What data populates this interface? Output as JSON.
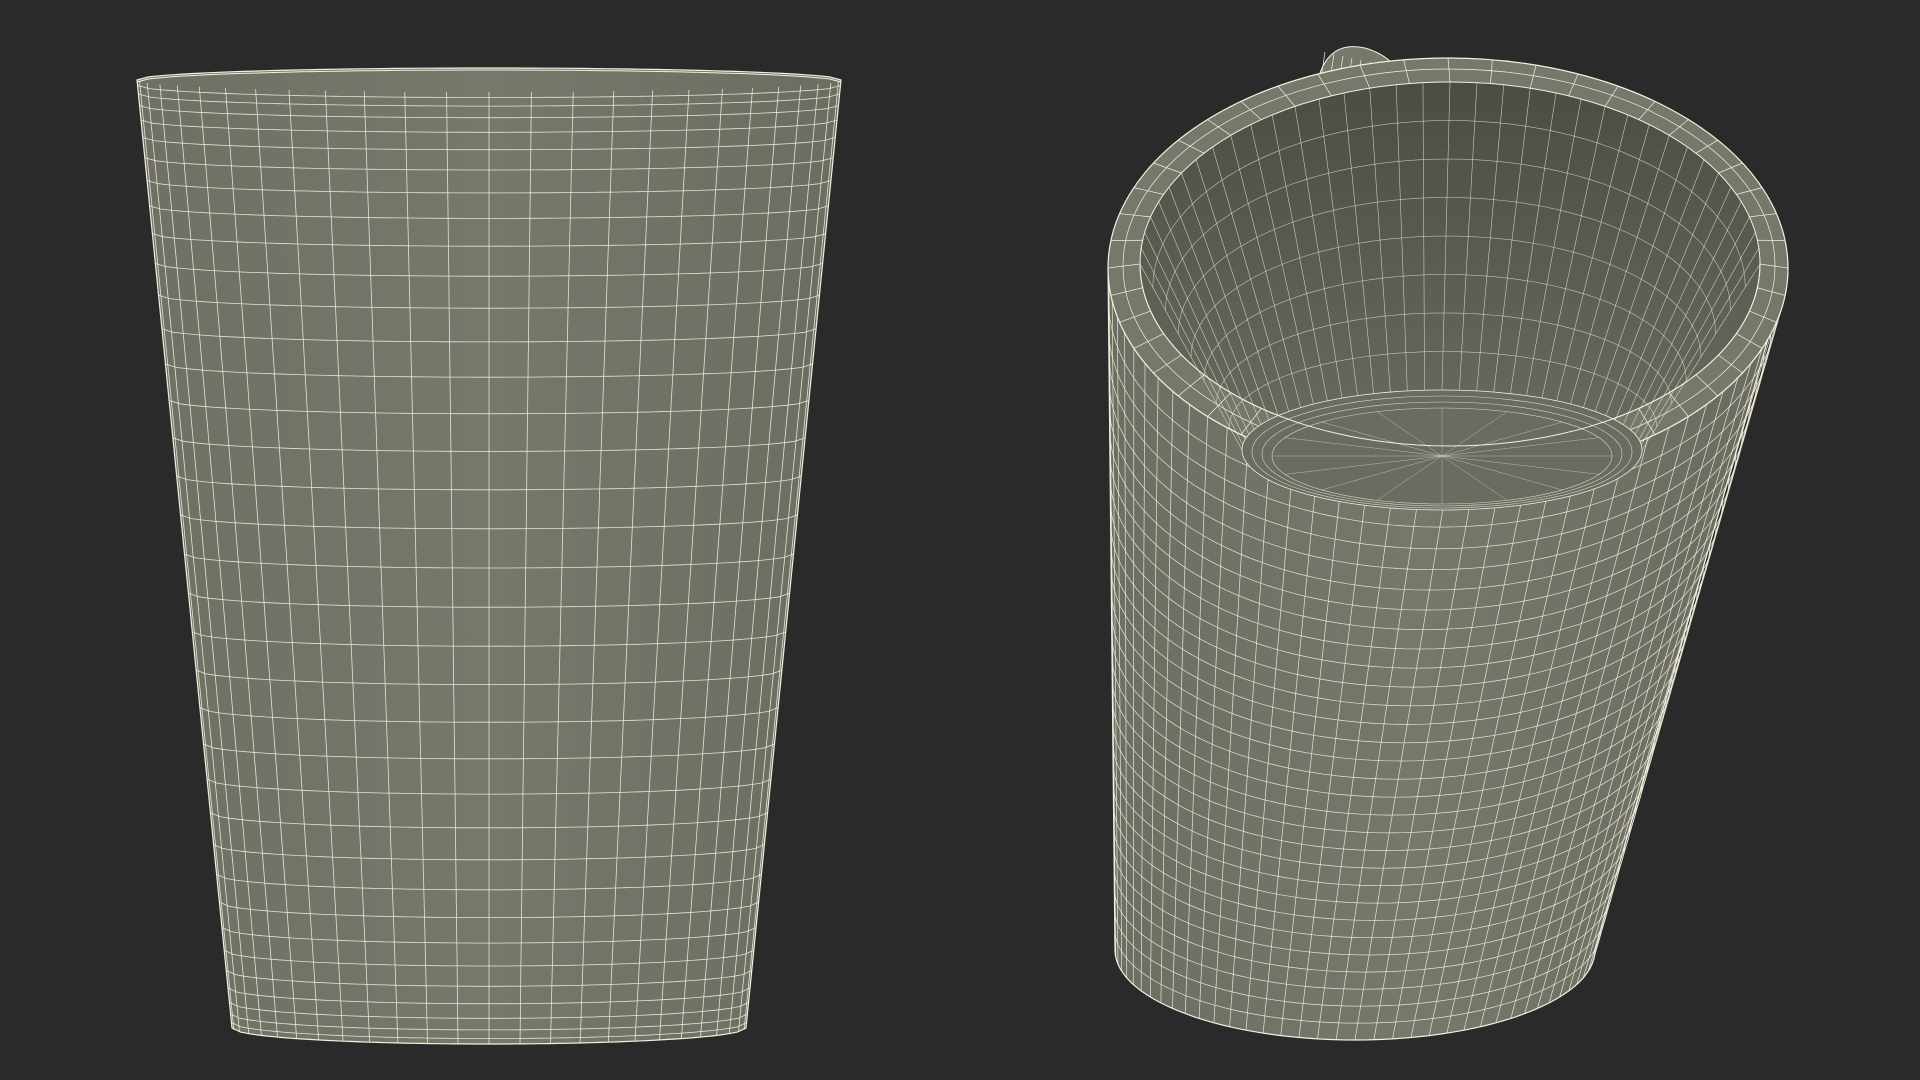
{
  "scene": {
    "background_color": "#2a2a2a",
    "mesh_fill_color": "#77786c",
    "mesh_shadow_color": "#4e4f46",
    "interior_color": "#5b5c52",
    "wire_color": "#f3f0dc"
  },
  "views": [
    {
      "name": "front-orthographic-view",
      "subject": "mug-body-wireframe"
    },
    {
      "name": "perspective-top-view",
      "subject": "mug-with-handle-wireframe"
    }
  ]
}
